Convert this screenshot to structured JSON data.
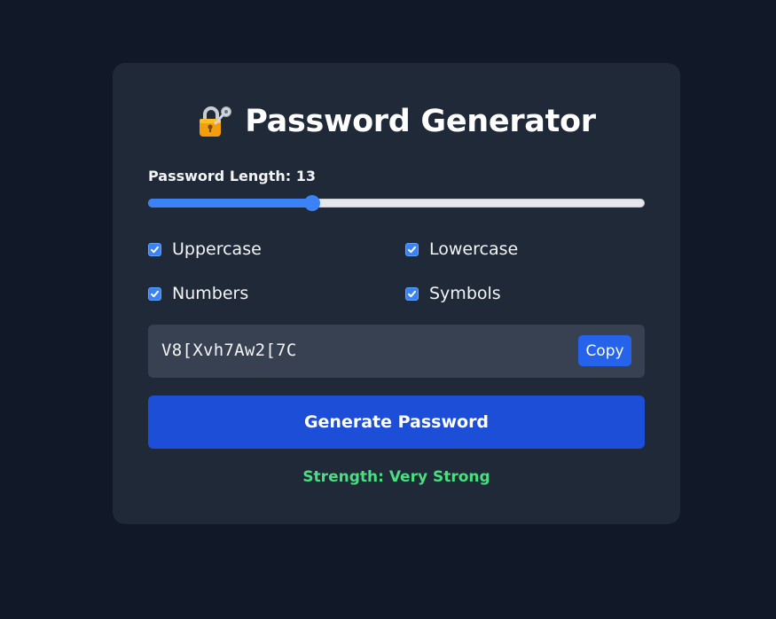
{
  "app": {
    "title": "Password Generator",
    "title_icon": "lock-with-key-icon"
  },
  "length": {
    "label": "Password Length: 13",
    "value": 13,
    "fraction": 0.33
  },
  "options": [
    {
      "label": "Uppercase",
      "checked": true
    },
    {
      "label": "Lowercase",
      "checked": true
    },
    {
      "label": "Numbers",
      "checked": true
    },
    {
      "label": "Symbols",
      "checked": true
    }
  ],
  "output": {
    "password": "V8[Xvh7Aw2[7C",
    "copy_label": "Copy"
  },
  "generate_label": "Generate Password",
  "strength_text": "Strength: Very Strong",
  "colors": {
    "background": "#111827",
    "card": "#1f2937",
    "output_bg": "#374151",
    "accent": "#3b82f6",
    "button": "#1d4ed8",
    "strength": "#4ade80"
  }
}
